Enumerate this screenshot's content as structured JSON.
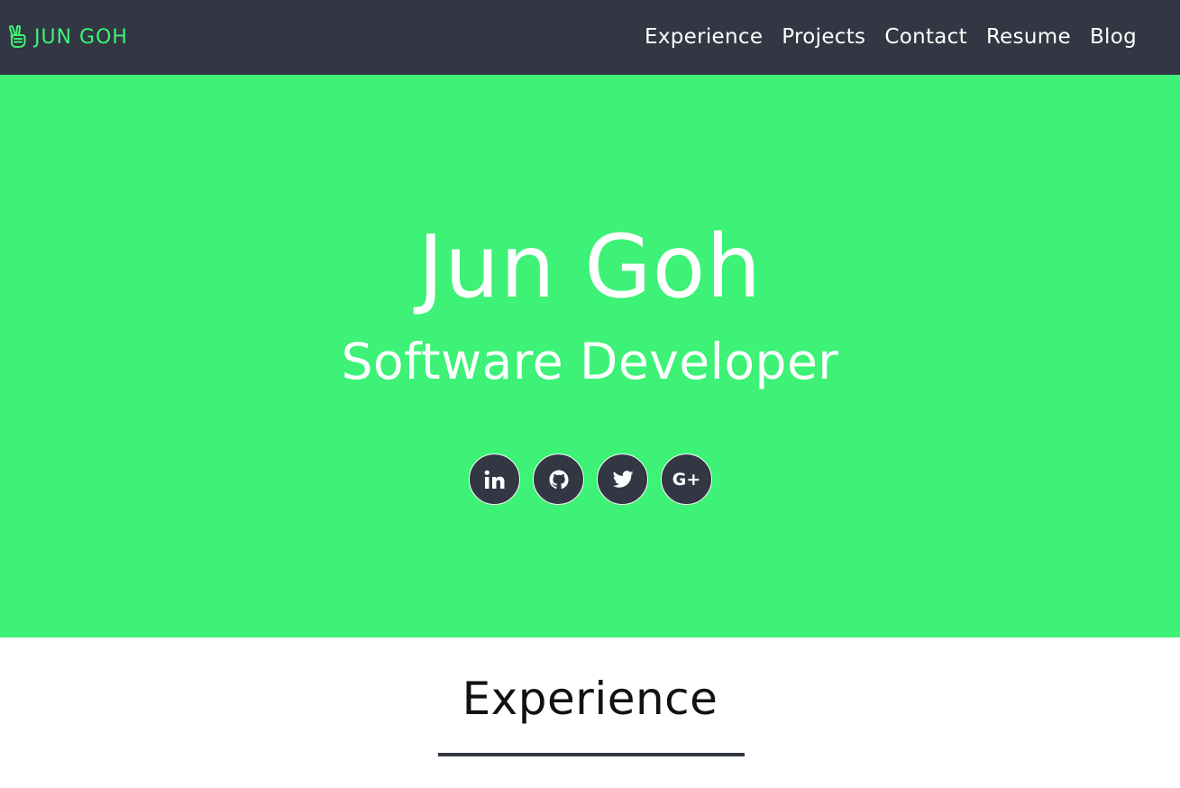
{
  "colors": {
    "nav_bg": "#323743",
    "accent": "#3df276",
    "hero_bg": "#3df276",
    "text_light": "#ffffff"
  },
  "navbar": {
    "brand": {
      "icon": "peace-hand-icon",
      "label": "JUN GOH"
    },
    "links": [
      {
        "label": "Experience"
      },
      {
        "label": "Projects"
      },
      {
        "label": "Contact"
      },
      {
        "label": "Resume"
      },
      {
        "label": "Blog"
      }
    ]
  },
  "hero": {
    "name": "Jun Goh",
    "role": "Software Developer",
    "social": [
      {
        "icon": "linkedin-icon",
        "glyph": "in"
      },
      {
        "icon": "github-icon"
      },
      {
        "icon": "twitter-icon"
      },
      {
        "icon": "google-plus-icon",
        "glyph": "G+"
      }
    ]
  },
  "section": {
    "title": "Experience"
  }
}
